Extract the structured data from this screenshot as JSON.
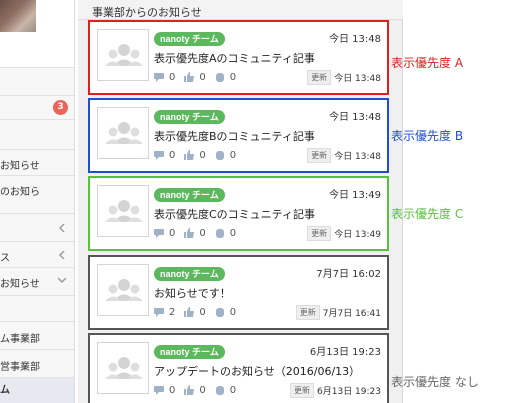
{
  "sidebar": {
    "badge": "3",
    "items": [
      {
        "label": ""
      },
      {
        "label": ""
      },
      {
        "label": "お知らせ"
      },
      {
        "label": "のお知ら"
      },
      {
        "label": ""
      },
      {
        "label": "ス"
      },
      {
        "label": "お知らせ"
      },
      {
        "label": ""
      },
      {
        "label": "ム事業部"
      },
      {
        "label": "営事業部"
      },
      {
        "label": "ム"
      }
    ]
  },
  "feed": {
    "header": "事業部からのお知らせ",
    "cards": [
      {
        "tag": "nanoty チーム",
        "date": "今日 13:48",
        "title": "表示優先度Aのコミュニティ記事",
        "comments": "0",
        "likes": "0",
        "bookmarks": "0",
        "update_label": "更新",
        "updated": "今日 13:48"
      },
      {
        "tag": "nanoty チーム",
        "date": "今日 13:48",
        "title": "表示優先度Bのコミュニティ記事",
        "comments": "0",
        "likes": "0",
        "bookmarks": "0",
        "update_label": "更新",
        "updated": "今日 13:48"
      },
      {
        "tag": "nanoty チーム",
        "date": "今日 13:49",
        "title": "表示優先度Cのコミュニティ記事",
        "comments": "0",
        "likes": "0",
        "bookmarks": "0",
        "update_label": "更新",
        "updated": "今日 13:49"
      },
      {
        "tag": "nanoty チーム",
        "date": "7月7日 16:02",
        "title": "お知らせです！",
        "comments": "2",
        "likes": "0",
        "bookmarks": "0",
        "update_label": "更新",
        "updated": "7月7日 16:41"
      },
      {
        "tag": "nanoty チーム",
        "date": "6月13日 19:23",
        "title": "アップデートのお知らせ（2016/06/13）",
        "comments": "0",
        "likes": "0",
        "bookmarks": "0",
        "update_label": "更新",
        "updated": "6月13日 19:23"
      }
    ]
  },
  "annotations": {
    "a": "表示優先度 A",
    "b": "表示優先度 B",
    "c": "表示優先度 C",
    "none": "表示優先度 なし"
  },
  "colors": {
    "red": "#e0201f",
    "blue": "#1f4fd0",
    "green": "#59c13d",
    "tag": "#5cb85c",
    "badge": "#e8655a"
  }
}
